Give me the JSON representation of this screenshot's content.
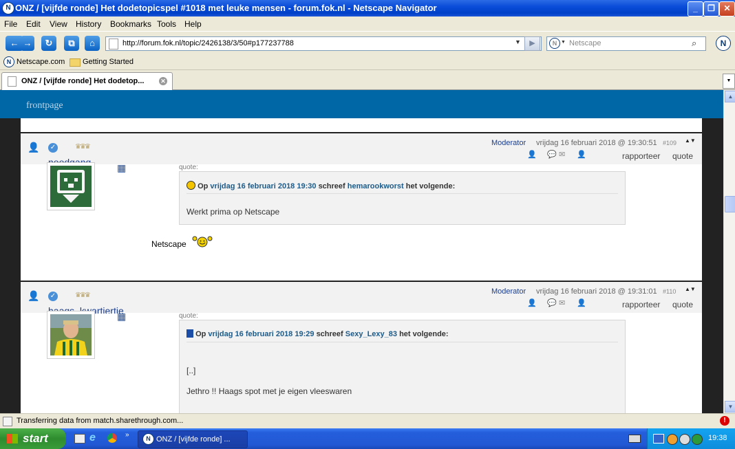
{
  "window": {
    "title": "ONZ / [vijfde ronde] Het dodetopicspel #1018 met leuke mensen - forum.fok.nl - Netscape Navigator"
  },
  "menu": [
    "File",
    "Edit",
    "View",
    "History",
    "Bookmarks",
    "Tools",
    "Help"
  ],
  "nav": {
    "url": "http://forum.fok.nl/topic/2426138/3/50#p177237788",
    "search_placeholder": "Netscape"
  },
  "bookmarks": [
    "Netscape.com",
    "Getting Started"
  ],
  "tab": {
    "title": "ONZ / [vijfde ronde] Het dodetop..."
  },
  "page": {
    "frontpage_label": "frontpage",
    "posts": [
      {
        "username": "noodgang",
        "role": "Moderator",
        "date": "vrijdag 16 februari 2018 @ 19:30:51",
        "number": "#109",
        "report_label": "rapporteer",
        "quote_label": "quote",
        "quote": {
          "label": "quote:",
          "prefix": "Op",
          "date": "vrijdag 16 februari 2018 19:30",
          "wrote": "schreef",
          "author": "hemarookworst",
          "suffix": "het volgende:",
          "lines": [
            "Werkt prima op Netscape"
          ]
        },
        "body": "Netscape"
      },
      {
        "username": "haags_kwartiertje",
        "role": "Moderator",
        "date": "vrijdag 16 februari 2018 @ 19:31:01",
        "number": "#110",
        "report_label": "rapporteer",
        "quote_label": "quote",
        "quote": {
          "label": "quote:",
          "prefix": "Op",
          "date": "vrijdag 16 februari 2018 19:29",
          "wrote": "schreef",
          "author": "Sexy_Lexy_83",
          "suffix": "het volgende:",
          "lines": [
            "[..]",
            "Jethro !! Haags spot met je eigen vleeswaren"
          ]
        }
      }
    ]
  },
  "status": {
    "text": "Transferring data from match.sharethrough.com..."
  },
  "taskbar": {
    "start_label": "start",
    "task_title": "ONZ / [vijfde ronde] ...",
    "clock": "19:38"
  }
}
